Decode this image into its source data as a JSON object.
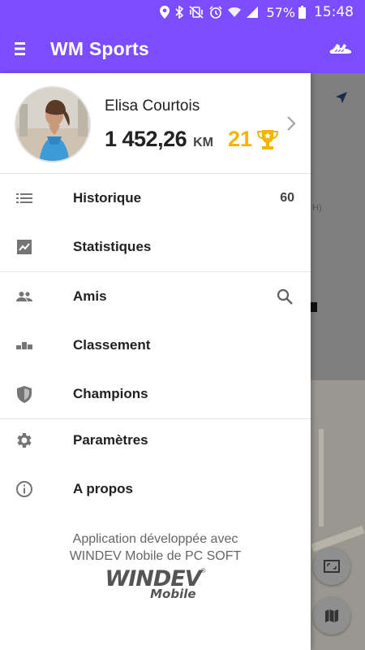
{
  "status_bar": {
    "battery": "57%",
    "time": "15:48",
    "icons": [
      "location-icon",
      "bluetooth-icon",
      "vibrate-icon",
      "alarm-icon",
      "wifi-icon",
      "signal-icon",
      "battery-icon"
    ]
  },
  "app_bar": {
    "title": "WM Sports",
    "menu_icon": "hamburger-icon",
    "action_icon": "runner-shoe-icon"
  },
  "profile": {
    "name": "Elisa Courtois",
    "distance": "1 452,26",
    "distance_unit": "KM",
    "trophies": "21",
    "trophy_icon": "trophy-icon"
  },
  "menu": {
    "items": [
      {
        "label": "Historique",
        "icon": "list-icon",
        "count": "60"
      },
      {
        "label": "Statistiques",
        "icon": "chart-icon"
      },
      {
        "label": "Amis",
        "icon": "people-icon",
        "action_icon": "search-icon"
      },
      {
        "label": "Classement",
        "icon": "podium-icon"
      },
      {
        "label": "Champions",
        "icon": "shield-icon"
      },
      {
        "label": "Paramètres",
        "icon": "gear-icon"
      },
      {
        "label": "A propos",
        "icon": "info-icon"
      }
    ]
  },
  "footer": {
    "line1": "Application développée avec",
    "line2": "WINDEV Mobile de PC SOFT",
    "logo_name": "WINDEV",
    "logo_sub": "Mobile"
  },
  "background": {
    "partial_text": "H)"
  },
  "colors": {
    "primary": "#7c4dff",
    "trophy": "#f4b400",
    "text": "#212121"
  }
}
